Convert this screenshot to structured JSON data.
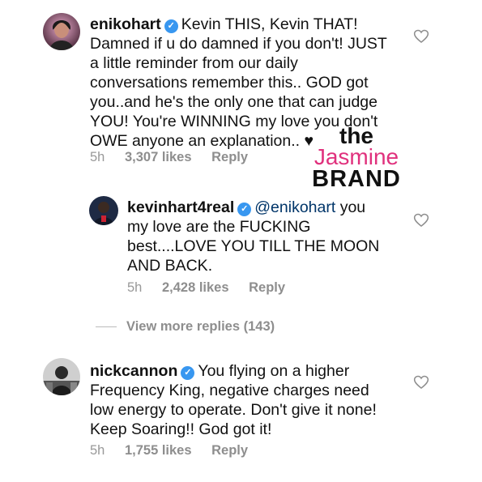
{
  "comments": [
    {
      "username": "enikohart",
      "text": "Kevin THIS, Kevin THAT! Damned if u do damned if you don't! JUST a little reminder from our daily conversations remember this.. GOD got you..and he's the only one that can judge YOU! You're WINNING my love you don't OWE anyone an explanation.. ♥",
      "time": "5h",
      "likes": "3,307 likes",
      "reply": "Reply"
    },
    {
      "username": "kevinhart4real",
      "mention": "@enikohart",
      "text": "you my love are the FUCKING best....LOVE YOU TILL THE MOON AND BACK.",
      "time": "5h",
      "likes": "2,428 likes",
      "reply": "Reply"
    },
    {
      "username": "nickcannon",
      "text": "You flying on a higher Frequency King, negative charges need low energy to operate. Don't give it none! Keep Soaring!! God got it!",
      "time": "5h",
      "likes": "1,755 likes",
      "reply": "Reply"
    }
  ],
  "view_more": "View more replies (143)",
  "watermark": {
    "line1": "the",
    "line2": "Jasmine",
    "line3": "BRAND"
  },
  "icons": {
    "verified": "verified-badge-icon",
    "like": "heart-outline-icon"
  },
  "colors": {
    "verified": "#3897f0",
    "mention": "#003569",
    "meta": "#8e8e8e",
    "brand_pink": "#e0317d"
  }
}
